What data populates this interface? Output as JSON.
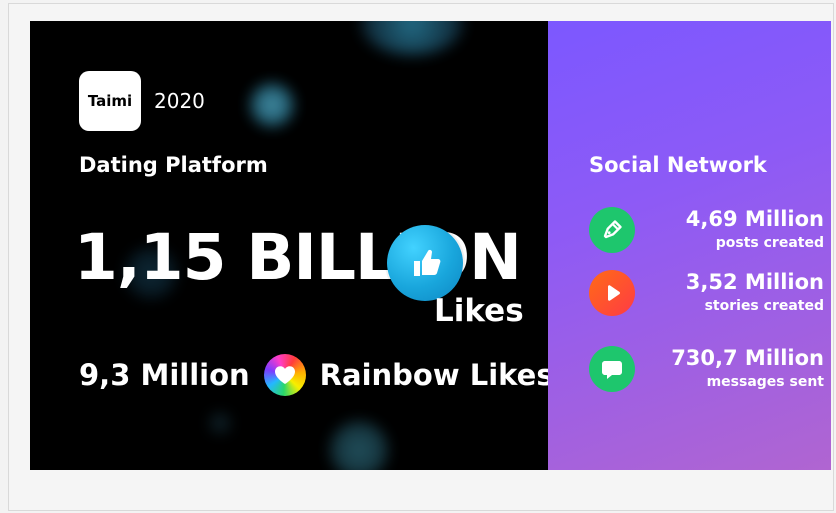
{
  "brand": {
    "logo_text": "Taimi",
    "year": "2020"
  },
  "dating": {
    "title": "Dating Platform",
    "likes_total": "1,15 BILLION",
    "likes_label": "Likes",
    "rainbow_likes_count": "9,3 Million",
    "rainbow_likes_label": "Rainbow Likes"
  },
  "social": {
    "title": "Social Network",
    "stats": [
      {
        "value": "4,69 Million",
        "label": "posts created",
        "icon": "pencil-icon"
      },
      {
        "value": "3,52 Million",
        "label": "stories created",
        "icon": "play-icon"
      },
      {
        "value": "730,7 Million",
        "label": "messages sent",
        "icon": "chat-bubble-icon"
      }
    ]
  },
  "colors": {
    "dating_background": "#000000",
    "social_gradient_start": "#7c58ff",
    "social_gradient_end": "#b065d1",
    "like_badge": "#19a6dc",
    "posts_icon": "#1ec66d",
    "stories_icon": "#ff4b2e",
    "messages_icon": "#1ec66d"
  }
}
